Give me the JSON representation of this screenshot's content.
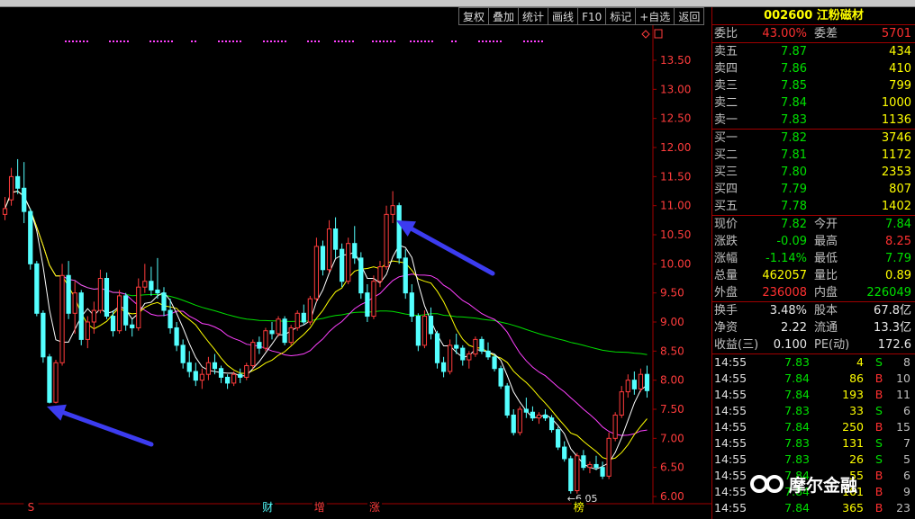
{
  "colors": {
    "background": "#000000",
    "candle_up": "#ff3c3c",
    "candle_down": "#54ffff",
    "ma5": "#ffffff",
    "ma10": "#ffff00",
    "ma20": "#ff40ff",
    "ma60": "#00e000",
    "price_label": "#ff3c3c",
    "annotation_arrow": "#3c3cf0"
  },
  "toolbar": [
    "复权",
    "叠加",
    "统计",
    "画线",
    "F10",
    "标记",
    "+自选",
    "返回"
  ],
  "chart_data": {
    "type": "candlestick",
    "y_ticks": [
      "13.50",
      "13.00",
      "12.50",
      "12.00",
      "11.50",
      "11.00",
      "10.50",
      "10.00",
      "9.50",
      "9.00",
      "8.50",
      "8.00",
      "7.50",
      "7.00",
      "6.50",
      "6.00"
    ],
    "ylim": [
      6.0,
      13.5
    ],
    "candles": [
      [
        10.85,
        11.15,
        10.75,
        10.95
      ],
      [
        11.1,
        11.65,
        11.0,
        11.5
      ],
      [
        11.5,
        11.8,
        11.2,
        11.3
      ],
      [
        11.3,
        11.75,
        10.7,
        10.9
      ],
      [
        10.9,
        10.95,
        9.9,
        10.0
      ],
      [
        10.0,
        10.05,
        9.1,
        9.15
      ],
      [
        9.15,
        9.2,
        8.3,
        8.4
      ],
      [
        8.4,
        8.45,
        7.6,
        7.62
      ],
      [
        7.62,
        8.35,
        7.6,
        8.3
      ],
      [
        8.3,
        10.0,
        8.25,
        9.8
      ],
      [
        9.8,
        10.05,
        9.05,
        9.15
      ],
      [
        9.15,
        9.7,
        8.8,
        9.5
      ],
      [
        9.5,
        9.55,
        8.6,
        8.7
      ],
      [
        8.7,
        9.1,
        8.55,
        9.0
      ],
      [
        9.0,
        9.35,
        8.8,
        9.2
      ],
      [
        9.2,
        9.9,
        9.15,
        9.75
      ],
      [
        9.75,
        9.85,
        9.05,
        9.1
      ],
      [
        9.1,
        9.2,
        8.75,
        8.85
      ],
      [
        8.85,
        9.55,
        8.8,
        9.45
      ],
      [
        9.45,
        9.5,
        8.85,
        8.95
      ],
      [
        8.95,
        9.05,
        8.75,
        8.9
      ],
      [
        8.9,
        9.75,
        8.85,
        9.6
      ],
      [
        9.6,
        10.0,
        9.5,
        9.7
      ],
      [
        9.7,
        9.95,
        9.45,
        9.55
      ],
      [
        9.55,
        10.1,
        9.4,
        9.5
      ],
      [
        9.5,
        9.6,
        9.1,
        9.2
      ],
      [
        9.2,
        9.4,
        8.8,
        8.9
      ],
      [
        8.9,
        9.0,
        8.5,
        8.6
      ],
      [
        8.6,
        8.7,
        8.2,
        8.3
      ],
      [
        8.3,
        8.5,
        8.05,
        8.15
      ],
      [
        8.15,
        8.3,
        7.9,
        8.0
      ],
      [
        8.0,
        8.2,
        7.85,
        8.1
      ],
      [
        8.1,
        8.4,
        8.0,
        8.3
      ],
      [
        8.3,
        8.45,
        8.1,
        8.2
      ],
      [
        8.2,
        8.25,
        7.95,
        8.05
      ],
      [
        8.05,
        8.1,
        7.85,
        7.95
      ],
      [
        7.95,
        8.15,
        7.9,
        8.1
      ],
      [
        8.1,
        8.2,
        7.95,
        8.05
      ],
      [
        8.05,
        8.3,
        8.0,
        8.25
      ],
      [
        8.25,
        8.7,
        8.2,
        8.65
      ],
      [
        8.65,
        8.75,
        8.45,
        8.55
      ],
      [
        8.55,
        8.9,
        8.5,
        8.85
      ],
      [
        8.85,
        9.0,
        8.7,
        8.8
      ],
      [
        8.8,
        9.1,
        8.75,
        9.05
      ],
      [
        9.05,
        9.1,
        8.6,
        8.65
      ],
      [
        8.65,
        8.95,
        8.6,
        8.9
      ],
      [
        8.9,
        9.2,
        8.85,
        9.15
      ],
      [
        9.15,
        9.3,
        8.95,
        9.0
      ],
      [
        9.0,
        9.45,
        8.95,
        9.4
      ],
      [
        9.4,
        10.45,
        9.35,
        10.3
      ],
      [
        10.3,
        10.4,
        9.8,
        9.9
      ],
      [
        9.9,
        10.75,
        9.85,
        10.6
      ],
      [
        10.6,
        10.8,
        10.1,
        10.25
      ],
      [
        10.25,
        10.35,
        9.6,
        9.7
      ],
      [
        9.7,
        10.45,
        9.65,
        10.35
      ],
      [
        10.35,
        10.65,
        10.0,
        10.1
      ],
      [
        10.1,
        10.2,
        9.4,
        9.5
      ],
      [
        9.5,
        9.65,
        9.0,
        9.1
      ],
      [
        9.1,
        9.8,
        9.05,
        9.7
      ],
      [
        9.7,
        10.05,
        9.6,
        9.95
      ],
      [
        9.95,
        11.0,
        9.9,
        10.85
      ],
      [
        10.85,
        11.25,
        10.7,
        11.0
      ],
      [
        11.0,
        11.05,
        10.0,
        10.1
      ],
      [
        10.1,
        10.25,
        9.4,
        9.5
      ],
      [
        9.5,
        9.65,
        9.0,
        9.1
      ],
      [
        9.1,
        9.15,
        8.5,
        8.6
      ],
      [
        8.6,
        9.2,
        8.55,
        9.1
      ],
      [
        9.1,
        9.25,
        8.7,
        8.8
      ],
      [
        8.8,
        8.85,
        8.2,
        8.3
      ],
      [
        8.3,
        8.4,
        8.05,
        8.15
      ],
      [
        8.15,
        8.7,
        8.1,
        8.6
      ],
      [
        8.6,
        8.8,
        8.45,
        8.55
      ],
      [
        8.55,
        8.6,
        8.25,
        8.35
      ],
      [
        8.35,
        8.5,
        8.2,
        8.45
      ],
      [
        8.45,
        8.75,
        8.4,
        8.7
      ],
      [
        8.7,
        8.75,
        8.45,
        8.5
      ],
      [
        8.5,
        8.65,
        8.35,
        8.4
      ],
      [
        8.4,
        8.45,
        8.15,
        8.2
      ],
      [
        8.2,
        8.25,
        7.85,
        7.9
      ],
      [
        7.9,
        7.95,
        7.35,
        7.4
      ],
      [
        7.4,
        7.5,
        7.05,
        7.1
      ],
      [
        7.1,
        7.55,
        7.05,
        7.5
      ],
      [
        7.5,
        7.7,
        7.35,
        7.45
      ],
      [
        7.45,
        7.55,
        7.3,
        7.35
      ],
      [
        7.35,
        7.45,
        7.25,
        7.4
      ],
      [
        7.4,
        7.5,
        7.3,
        7.35
      ],
      [
        7.35,
        7.4,
        7.1,
        7.15
      ],
      [
        7.15,
        7.2,
        6.8,
        6.85
      ],
      [
        6.85,
        6.95,
        6.6,
        6.65
      ],
      [
        6.65,
        6.7,
        6.05,
        6.1
      ],
      [
        6.1,
        6.75,
        6.05,
        6.7
      ],
      [
        6.7,
        6.8,
        6.45,
        6.5
      ],
      [
        6.5,
        6.6,
        6.4,
        6.55
      ],
      [
        6.55,
        6.7,
        6.45,
        6.5
      ],
      [
        6.5,
        6.6,
        6.3,
        6.35
      ],
      [
        6.35,
        7.1,
        6.3,
        7.0
      ],
      [
        7.0,
        7.45,
        6.95,
        7.4
      ],
      [
        7.4,
        7.9,
        7.35,
        7.8
      ],
      [
        7.8,
        8.1,
        7.7,
        8.0
      ],
      [
        8.0,
        8.15,
        7.75,
        7.85
      ],
      [
        7.85,
        8.2,
        7.8,
        8.1
      ],
      [
        8.1,
        8.25,
        7.7,
        7.82
      ]
    ],
    "low_label": "←6.05",
    "event_markers": [
      {
        "label": "S",
        "color": "#ff3c3c",
        "pos": 0.045
      },
      {
        "label": "财",
        "color": "#54ffff",
        "pos": 0.41
      },
      {
        "label": "增",
        "color": "#ff3c3c",
        "pos": 0.49
      },
      {
        "label": "涨",
        "color": "#ff3c3c",
        "pos": 0.575
      },
      {
        "label": "榜",
        "color": "#ffff00",
        "pos": 0.89
      }
    ]
  },
  "quote": {
    "code": "002600",
    "name": "江粉磁材",
    "weibi_label": "委比",
    "weibi_value": "43.00%",
    "weicha_label": "委差",
    "weicha_value": "5701",
    "sell": [
      {
        "label": "卖五",
        "price": "7.87",
        "qty": "434"
      },
      {
        "label": "卖四",
        "price": "7.86",
        "qty": "410"
      },
      {
        "label": "卖三",
        "price": "7.85",
        "qty": "799"
      },
      {
        "label": "卖二",
        "price": "7.84",
        "qty": "1000"
      },
      {
        "label": "卖一",
        "price": "7.83",
        "qty": "1136"
      }
    ],
    "buy": [
      {
        "label": "买一",
        "price": "7.82",
        "qty": "3746"
      },
      {
        "label": "买二",
        "price": "7.81",
        "qty": "1172"
      },
      {
        "label": "买三",
        "price": "7.80",
        "qty": "2353"
      },
      {
        "label": "买四",
        "price": "7.79",
        "qty": "807"
      },
      {
        "label": "买五",
        "price": "7.78",
        "qty": "1402"
      }
    ],
    "stats": [
      {
        "l1": "现价",
        "v1": "7.82",
        "c1": "green",
        "l2": "今开",
        "v2": "7.84",
        "c2": "green"
      },
      {
        "l1": "涨跌",
        "v1": "-0.09",
        "c1": "green",
        "l2": "最高",
        "v2": "8.25",
        "c2": "red"
      },
      {
        "l1": "涨幅",
        "v1": "-1.14%",
        "c1": "green",
        "l2": "最低",
        "v2": "7.79",
        "c2": "green"
      },
      {
        "l1": "总量",
        "v1": "462057",
        "c1": "yellow",
        "l2": "量比",
        "v2": "0.89",
        "c2": "yellow"
      },
      {
        "l1": "外盘",
        "v1": "236008",
        "c1": "red",
        "l2": "内盘",
        "v2": "226049",
        "c2": "green"
      }
    ],
    "fund": [
      {
        "l1": "换手",
        "v1": "3.48%",
        "c1": "white",
        "l2": "股本",
        "v2": "67.8亿",
        "c2": "white"
      },
      {
        "l1": "净资",
        "v1": "2.22",
        "c1": "white",
        "l2": "流通",
        "v2": "13.3亿",
        "c2": "white"
      },
      {
        "l1": "收益(三)",
        "v1": "0.100",
        "c1": "white",
        "l2": "PE(动)",
        "v2": "172.6",
        "c2": "white"
      }
    ],
    "ticks": [
      {
        "time": "14:55",
        "price": "7.83",
        "vol": "4",
        "dir": "S",
        "cnt": "8"
      },
      {
        "time": "14:55",
        "price": "7.84",
        "vol": "86",
        "dir": "B",
        "cnt": "10"
      },
      {
        "time": "14:55",
        "price": "7.84",
        "vol": "193",
        "dir": "B",
        "cnt": "11"
      },
      {
        "time": "14:55",
        "price": "7.83",
        "vol": "33",
        "dir": "S",
        "cnt": "6"
      },
      {
        "time": "14:55",
        "price": "7.84",
        "vol": "250",
        "dir": "B",
        "cnt": "15"
      },
      {
        "time": "14:55",
        "price": "7.83",
        "vol": "131",
        "dir": "S",
        "cnt": "7"
      },
      {
        "time": "14:55",
        "price": "7.83",
        "vol": "26",
        "dir": "S",
        "cnt": "5"
      },
      {
        "time": "14:55",
        "price": "7.84",
        "vol": "55",
        "dir": "B",
        "cnt": "6"
      },
      {
        "time": "14:55",
        "price": "7.84",
        "vol": "101",
        "dir": "B",
        "cnt": "9"
      },
      {
        "time": "14:55",
        "price": "7.84",
        "vol": "365",
        "dir": "B",
        "cnt": "23"
      }
    ]
  },
  "watermark": "摩尔金融"
}
